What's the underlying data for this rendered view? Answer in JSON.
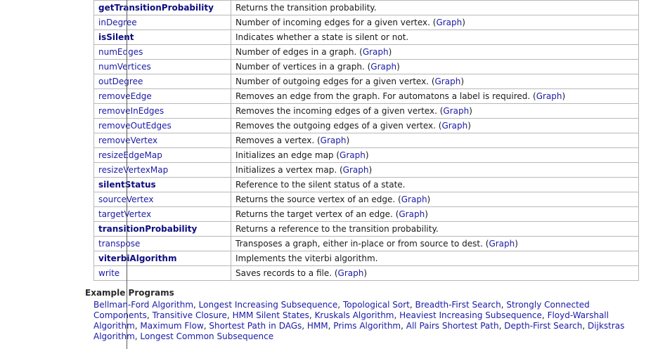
{
  "rows": [
    {
      "name": "getTransitionProbability",
      "bold": true,
      "desc": "Returns the transition probability.",
      "link": ""
    },
    {
      "name": "inDegree",
      "bold": false,
      "desc": "Number of incoming edges for a given vertex. (",
      "link": "Graph"
    },
    {
      "name": "isSilent",
      "bold": true,
      "desc": "Indicates whether a state is silent or not.",
      "link": ""
    },
    {
      "name": "numEdges",
      "bold": false,
      "desc": "Number of edges in a graph. (",
      "link": "Graph"
    },
    {
      "name": "numVertices",
      "bold": false,
      "desc": "Number of vertices in a graph. (",
      "link": "Graph"
    },
    {
      "name": "outDegree",
      "bold": false,
      "desc": "Number of outgoing edges for a given vertex. (",
      "link": "Graph"
    },
    {
      "name": "removeEdge",
      "bold": false,
      "desc": "Removes an edge from the graph. For automatons a label is required. (",
      "link": "Graph"
    },
    {
      "name": "removeInEdges",
      "bold": false,
      "desc": "Removes the incoming edges of a given vertex. (",
      "link": "Graph"
    },
    {
      "name": "removeOutEdges",
      "bold": false,
      "desc": "Removes the outgoing edges of a given vertex. (",
      "link": "Graph"
    },
    {
      "name": "removeVertex",
      "bold": false,
      "desc": "Removes a vertex. (",
      "link": "Graph"
    },
    {
      "name": "resizeEdgeMap",
      "bold": false,
      "desc": "Initializes an edge map (",
      "link": "Graph"
    },
    {
      "name": "resizeVertexMap",
      "bold": false,
      "desc": "Initializes a vertex map. (",
      "link": "Graph"
    },
    {
      "name": "silentStatus",
      "bold": true,
      "desc": "Reference to the silent status of a state.",
      "link": ""
    },
    {
      "name": "sourceVertex",
      "bold": false,
      "desc": "Returns the source vertex of an edge. (",
      "link": "Graph"
    },
    {
      "name": "targetVertex",
      "bold": false,
      "desc": "Returns the target vertex of an edge. (",
      "link": "Graph"
    },
    {
      "name": "transitionProbability",
      "bold": true,
      "desc": "Returns a reference to the transition probability.",
      "link": ""
    },
    {
      "name": "transpose",
      "bold": false,
      "desc": "Transposes a graph, either in-place or from source to dest. (",
      "link": "Graph"
    },
    {
      "name": "viterbiAlgorithm",
      "bold": true,
      "desc": "Implements the viterbi algorithm.",
      "link": ""
    },
    {
      "name": "write",
      "bold": false,
      "desc": "Saves records to a file. (",
      "link": "Graph"
    }
  ],
  "close_paren": ")",
  "examples": {
    "title": "Example Programs",
    "separator": ", ",
    "links": [
      "Bellman-Ford Algorithm",
      "Longest Increasing Subsequence",
      "Topological Sort",
      "Breadth-First Search",
      "Strongly Connected Components",
      "Transitive Closure",
      "HMM Silent States",
      "Kruskals Algorithm",
      "Heaviest Increasing Subsequence",
      "Floyd-Warshall Algorithm",
      "Maximum Flow",
      "Shortest Path in DAGs",
      "HMM",
      "Prims Algorithm",
      "All Pairs Shortest Path",
      "Depth-First Search",
      "Dijkstras Algorithm",
      "Longest Common Subsequence"
    ]
  }
}
